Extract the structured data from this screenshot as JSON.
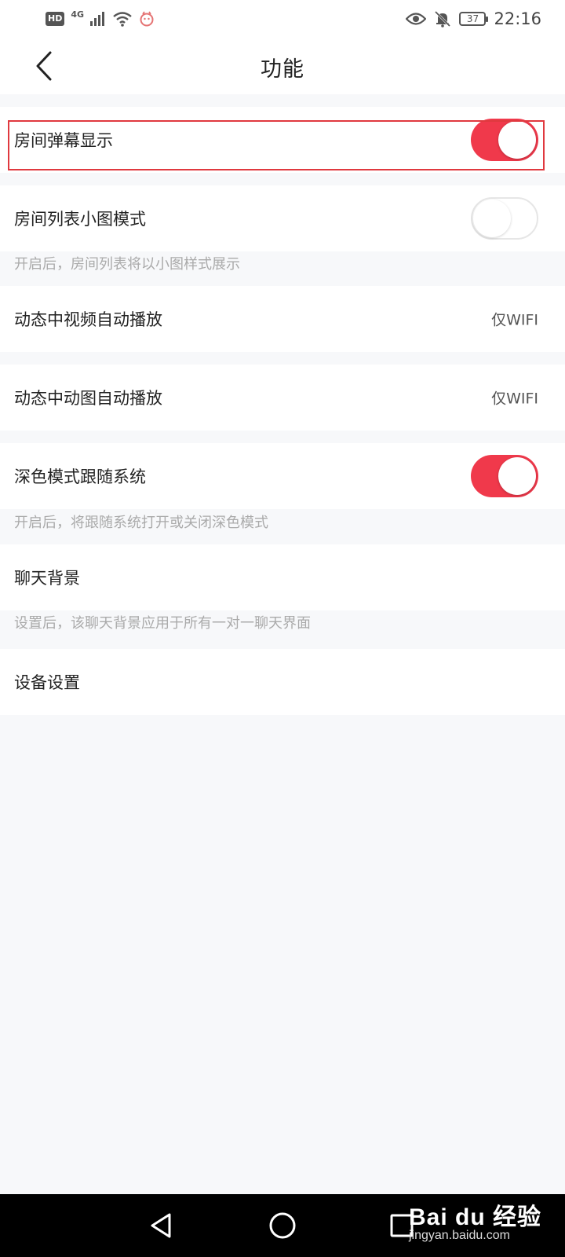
{
  "status_bar": {
    "hd": "HD",
    "network": "4G",
    "battery": "37",
    "time": "22:16"
  },
  "header": {
    "title": "功能"
  },
  "settings": [
    {
      "label": "房间弹幕显示",
      "type": "toggle",
      "on": true
    },
    {
      "label": "房间列表小图模式",
      "type": "toggle",
      "on": false,
      "desc": "开启后，房间列表将以小图样式展示"
    },
    {
      "label": "动态中视频自动播放",
      "type": "value",
      "value": "仅WIFI"
    },
    {
      "label": "动态中动图自动播放",
      "type": "value",
      "value": "仅WIFI"
    },
    {
      "label": "深色模式跟随系统",
      "type": "toggle",
      "on": true,
      "desc": "开启后，将跟随系统打开或关闭深色模式"
    },
    {
      "label": "聊天背景",
      "type": "link",
      "desc": "设置后，该聊天背景应用于所有一对一聊天界面"
    },
    {
      "label": "设备设置",
      "type": "link"
    }
  ],
  "watermark": {
    "brand": "Bai du 经验",
    "site": "jingyan.baidu.com"
  },
  "colors": {
    "accent": "#f0394b",
    "highlight_border": "#e0393f",
    "background": "#f7f8fa"
  }
}
